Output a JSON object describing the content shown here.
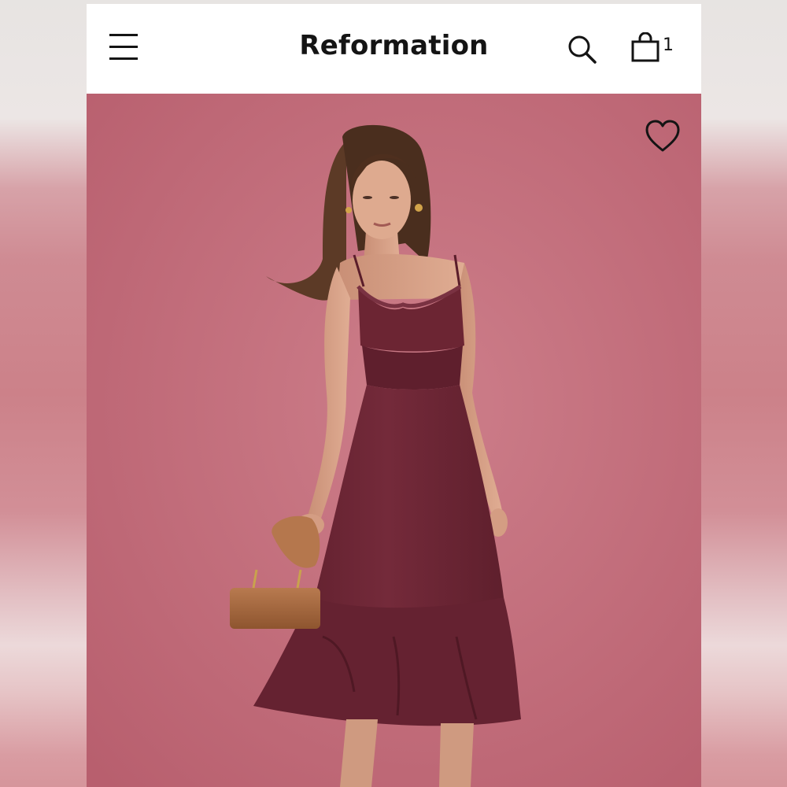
{
  "header": {
    "brand": "Reformation",
    "bag_count": "1",
    "icons": {
      "menu": "hamburger-menu-icon",
      "search": "search-icon",
      "bag": "shopping-bag-icon"
    }
  },
  "product_image": {
    "description_icon": "heart-icon",
    "background_color": "#c56f7d",
    "dress_color": "#6d2634"
  }
}
